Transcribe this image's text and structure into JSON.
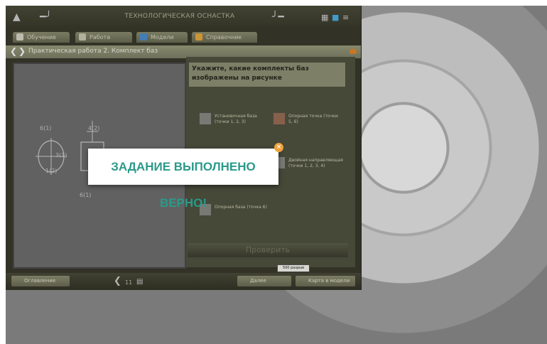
{
  "window": {
    "title": "ТЕХНОЛОГИЧЕСКАЯ ОСНАСТКА"
  },
  "tabs": [
    {
      "label": "Обучение",
      "icon": "book-icon"
    },
    {
      "label": "Работа",
      "icon": "person-icon"
    },
    {
      "label": "Модели",
      "icon": "cube-icon"
    },
    {
      "label": "Справочник",
      "icon": "help-icon"
    }
  ],
  "breadcrumb": {
    "title": "Практическая работа 2. Комплект баз"
  },
  "question": {
    "text": "Укажите, какие комплекты баз изображены на рисунке"
  },
  "options": [
    {
      "label": "Установочная база (точки 1, 2, 3)"
    },
    {
      "label": "Опорная точка (точки 5, 6)"
    },
    {
      "label": "Двойная направляющая (точки 1, 2, 3, 4)"
    },
    {
      "label": "Опорная база (точка 6)"
    }
  ],
  "check_button": {
    "label": "Проверить"
  },
  "bottom": {
    "left_button": "Оглавление",
    "page_indicator": "11",
    "next_button": "Далее",
    "map_button": "Карта в модели",
    "tooltip": "500 разрыв"
  },
  "drawing": {
    "labels": [
      "6(1)",
      "4(2)",
      "3(1)",
      "1(2)",
      "6(1)"
    ]
  },
  "modal": {
    "message": "ЗАДАНИЕ ВЫПОЛНЕНО ВЕРНО!"
  },
  "colors": {
    "accent": "#e1882c",
    "success": "#2a9a8a",
    "panel": "#3a3b2c"
  }
}
